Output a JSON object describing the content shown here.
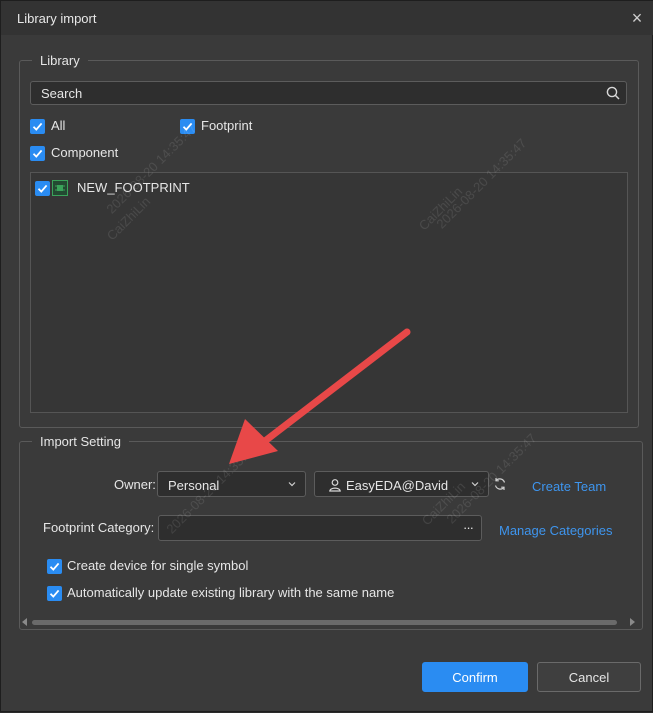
{
  "dialog": {
    "title": "Library import"
  },
  "library": {
    "legend": "Library",
    "search_placeholder": "Search",
    "filters": {
      "all": "All",
      "footprint": "Footprint",
      "component": "Component"
    },
    "items": [
      {
        "name": "NEW_FOOTPRINT"
      }
    ]
  },
  "import_setting": {
    "legend": "Import Setting",
    "owner_label": "Owner:",
    "owner_value": "Personal",
    "account_value": "EasyEDA@David",
    "create_team": "Create Team",
    "footprint_category_label": "Footprint Category:",
    "more_glyph": "···",
    "manage_categories": "Manage Categories",
    "create_device": "Create device for single symbol",
    "auto_update": "Automatically update existing library with the same name"
  },
  "buttons": {
    "confirm": "Confirm",
    "cancel": "Cancel"
  },
  "watermark": {
    "name": "CaiZhiLin",
    "timestamp": "2026-08-20 14:35:47"
  },
  "colors": {
    "accent": "#2a8cf2",
    "link": "#3e95ee",
    "annotation_arrow": "#e84848"
  }
}
